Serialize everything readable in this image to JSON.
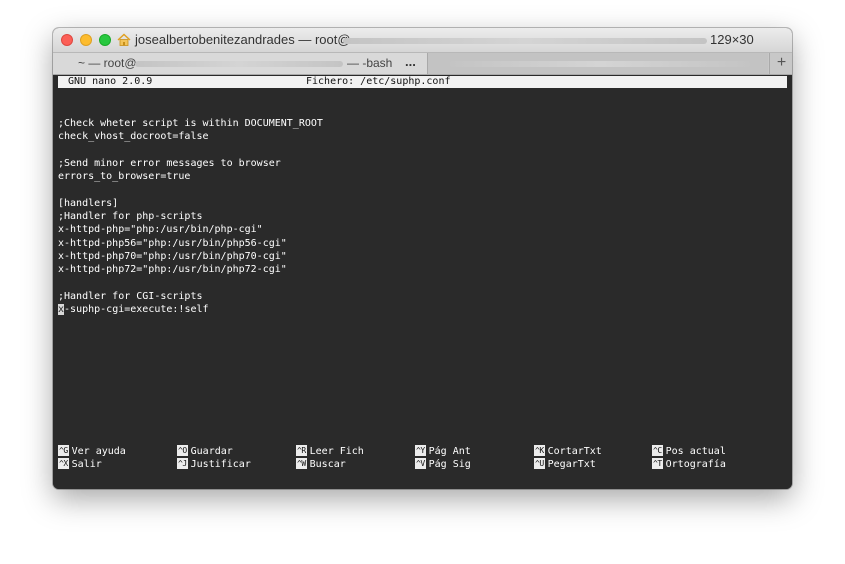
{
  "window": {
    "title": "josealbertobenitezandrades — root@",
    "size": "129×30",
    "tabs": [
      {
        "label_left": "~ — root@",
        "label_right": "— -bash",
        "active": true
      },
      {
        "label_left": "",
        "label_right": "",
        "active": false
      }
    ],
    "tab_overflow": "...",
    "new_tab": "+"
  },
  "nano": {
    "version": "GNU nano 2.0.9",
    "file": "Fichero: /etc/suphp.conf",
    "lines": [
      ";Check wheter script is within DOCUMENT_ROOT",
      "check_vhost_docroot=false",
      "",
      ";Send minor error messages to browser",
      "errors_to_browser=true",
      "",
      "[handlers]",
      ";Handler for php-scripts",
      "x-httpd-php=\"php:/usr/bin/php-cgi\"",
      "x-httpd-php56=\"php:/usr/bin/php56-cgi\"",
      "x-httpd-php70=\"php:/usr/bin/php70-cgi\"",
      "x-httpd-php72=\"php:/usr/bin/php72-cgi\"",
      "",
      ";Handler for CGI-scripts"
    ],
    "cursor_line": {
      "cursor_char": "x",
      "rest": "-suphp-cgi=execute:!self"
    },
    "shortcuts": [
      {
        "key": "^G",
        "label": "Ver ayuda"
      },
      {
        "key": "^O",
        "label": "Guardar"
      },
      {
        "key": "^R",
        "label": "Leer Fich"
      },
      {
        "key": "^Y",
        "label": "Pág Ant"
      },
      {
        "key": "^K",
        "label": "CortarTxt"
      },
      {
        "key": "^C",
        "label": "Pos actual"
      },
      {
        "key": "^X",
        "label": "Salir"
      },
      {
        "key": "^J",
        "label": "Justificar"
      },
      {
        "key": "^W",
        "label": "Buscar"
      },
      {
        "key": "^V",
        "label": "Pág Sig"
      },
      {
        "key": "^U",
        "label": "PegarTxt"
      },
      {
        "key": "^T",
        "label": "Ortografía"
      }
    ]
  }
}
